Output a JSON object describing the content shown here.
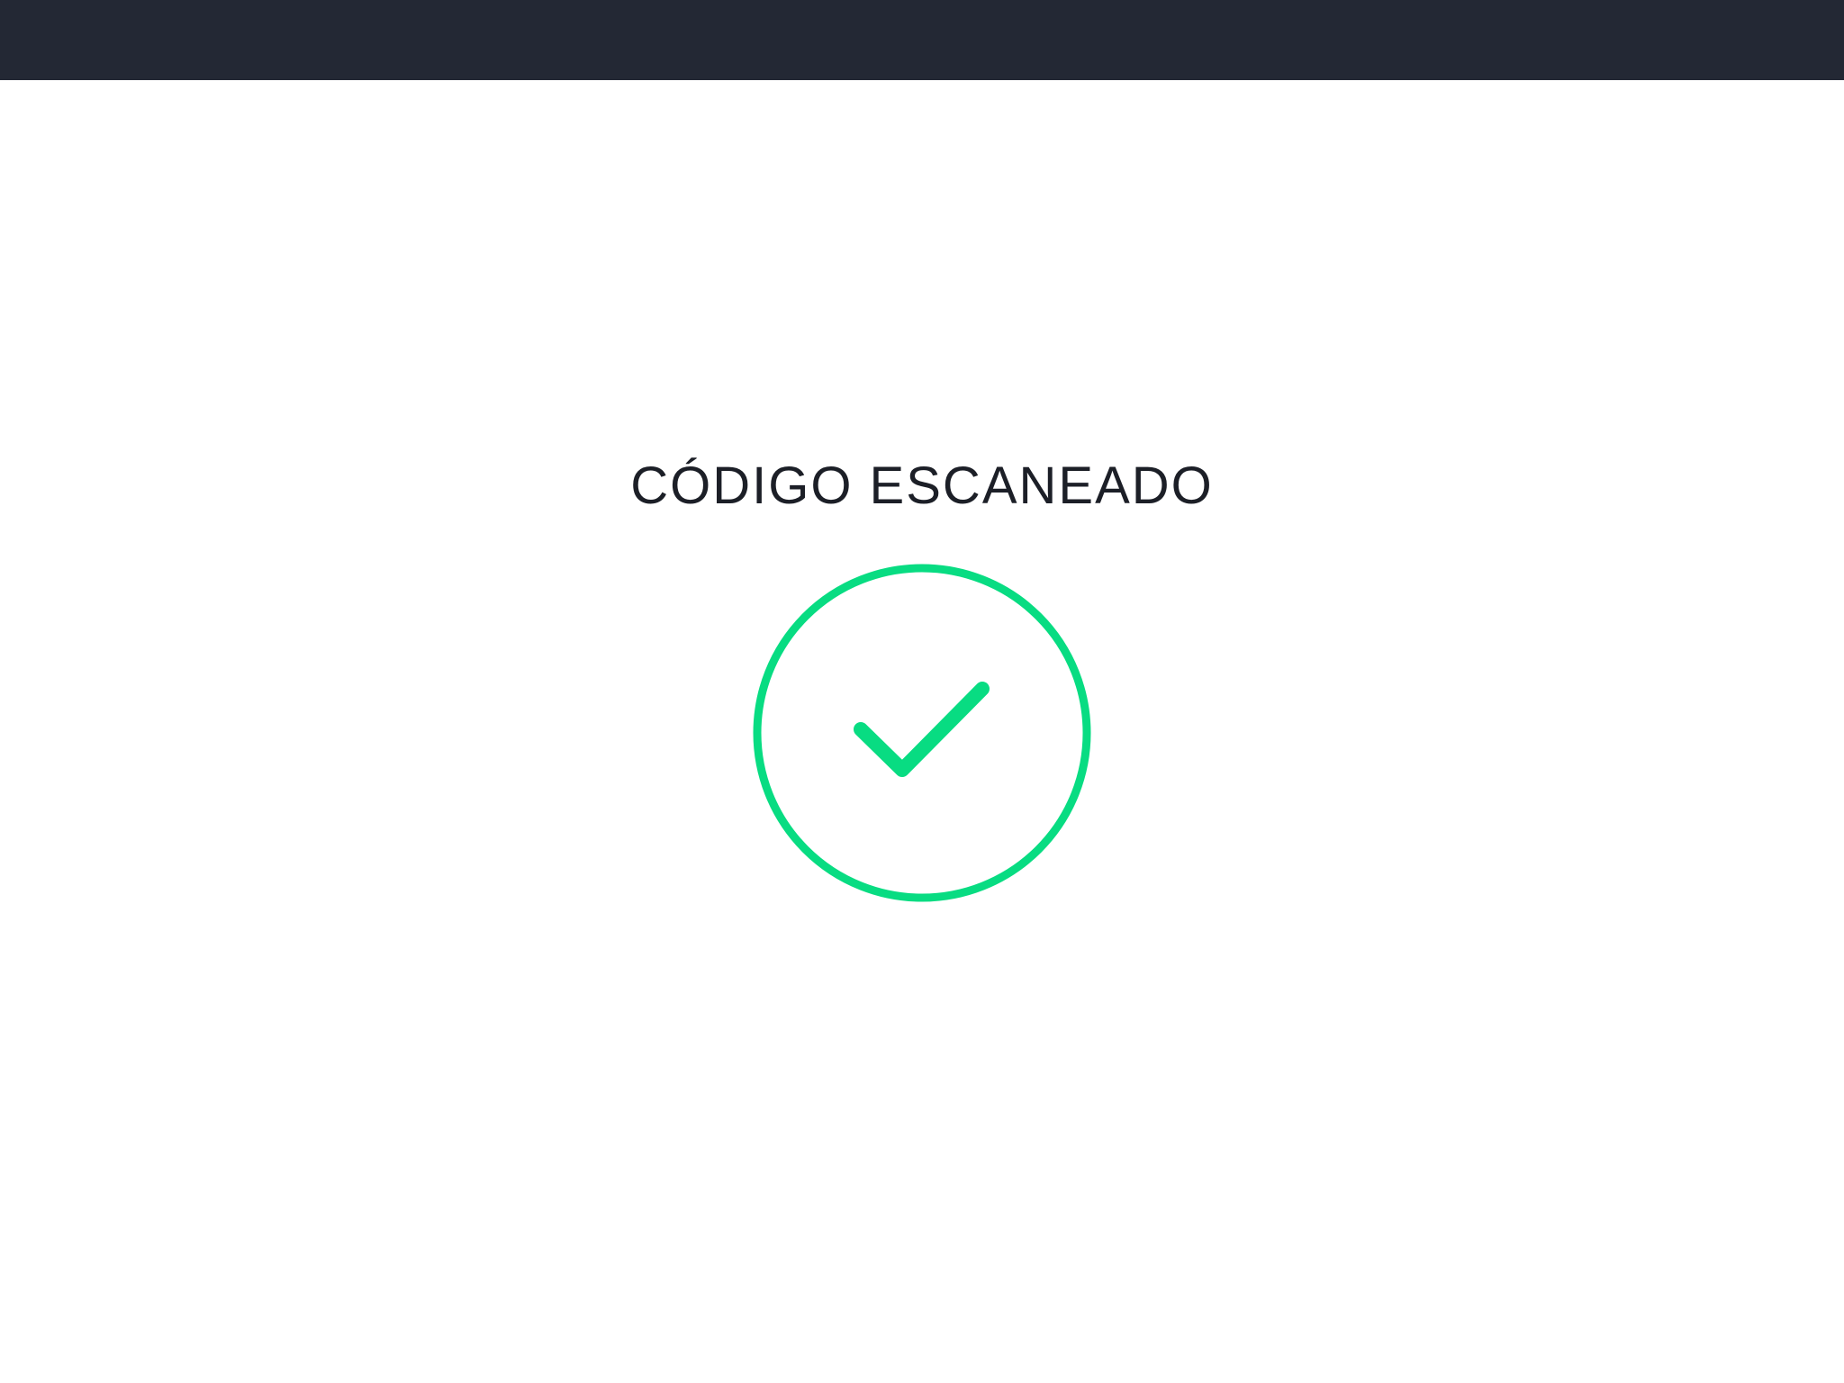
{
  "header": {
    "background_color": "#232834"
  },
  "status": {
    "title": "CÓDIGO ESCANEADO",
    "icon": "check-circle-icon",
    "accent_color": "#08DC82",
    "text_color": "#1C1F27"
  }
}
